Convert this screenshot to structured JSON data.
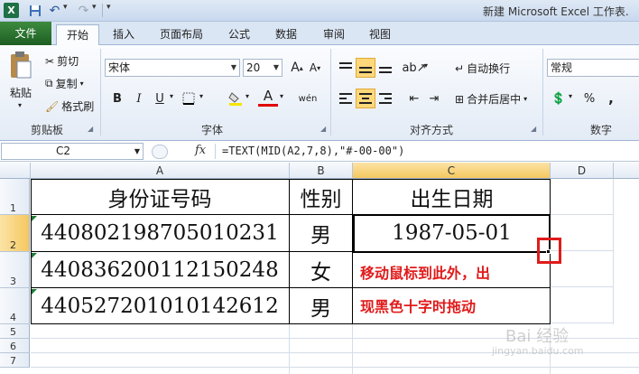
{
  "window": {
    "title": "新建 Microsoft Excel 工作表."
  },
  "quick_access": {
    "logo": "X",
    "save_icon": "floppy-disk",
    "undo_icon": "undo-arrow",
    "redo_icon": "redo-arrow"
  },
  "tabs": [
    "文件",
    "开始",
    "插入",
    "页面布局",
    "公式",
    "数据",
    "审阅",
    "视图"
  ],
  "ribbon": {
    "clipboard": {
      "paste": "粘贴",
      "cut": "剪切",
      "copy": "复制",
      "format_painter": "格式刷",
      "label": "剪贴板"
    },
    "font": {
      "name": "宋体",
      "size": "20",
      "bold": "B",
      "italic": "I",
      "underline": "U",
      "phonetic": "wén",
      "label": "字体"
    },
    "alignment": {
      "wrap_text": "自动换行",
      "merge_center": "合并后居中",
      "label": "对齐方式"
    },
    "number": {
      "format": "常规",
      "percent": "%",
      "comma": ",",
      "label": "数字"
    }
  },
  "formula_bar": {
    "name_box": "C2",
    "fx": "fx",
    "formula": "=TEXT(MID(A2,7,8),\"#-00-00\")"
  },
  "columns": [
    "A",
    "B",
    "C",
    "D"
  ],
  "rows": [
    "1",
    "2",
    "3",
    "4",
    "5",
    "6",
    "7"
  ],
  "cells": {
    "A1": "身份证号码",
    "B1": "性别",
    "C1": "出生日期",
    "A2": "440802198705010231",
    "B2": "男",
    "C2": "1987-05-01",
    "A3": "440836200112150248",
    "B3": "女",
    "A4": "440527201010142612",
    "B4": "男"
  },
  "annotation": {
    "line1": "移动鼠标到此外，出",
    "line2": "现黑色十字时拖动"
  },
  "watermark": {
    "line1": "Bai 经验",
    "line2": "jingyan.baidu.com"
  },
  "colors": {
    "annotation_red": "#e01b1b",
    "file_tab_green": "#2a6c2e",
    "selection_header": "#f6c85f"
  }
}
